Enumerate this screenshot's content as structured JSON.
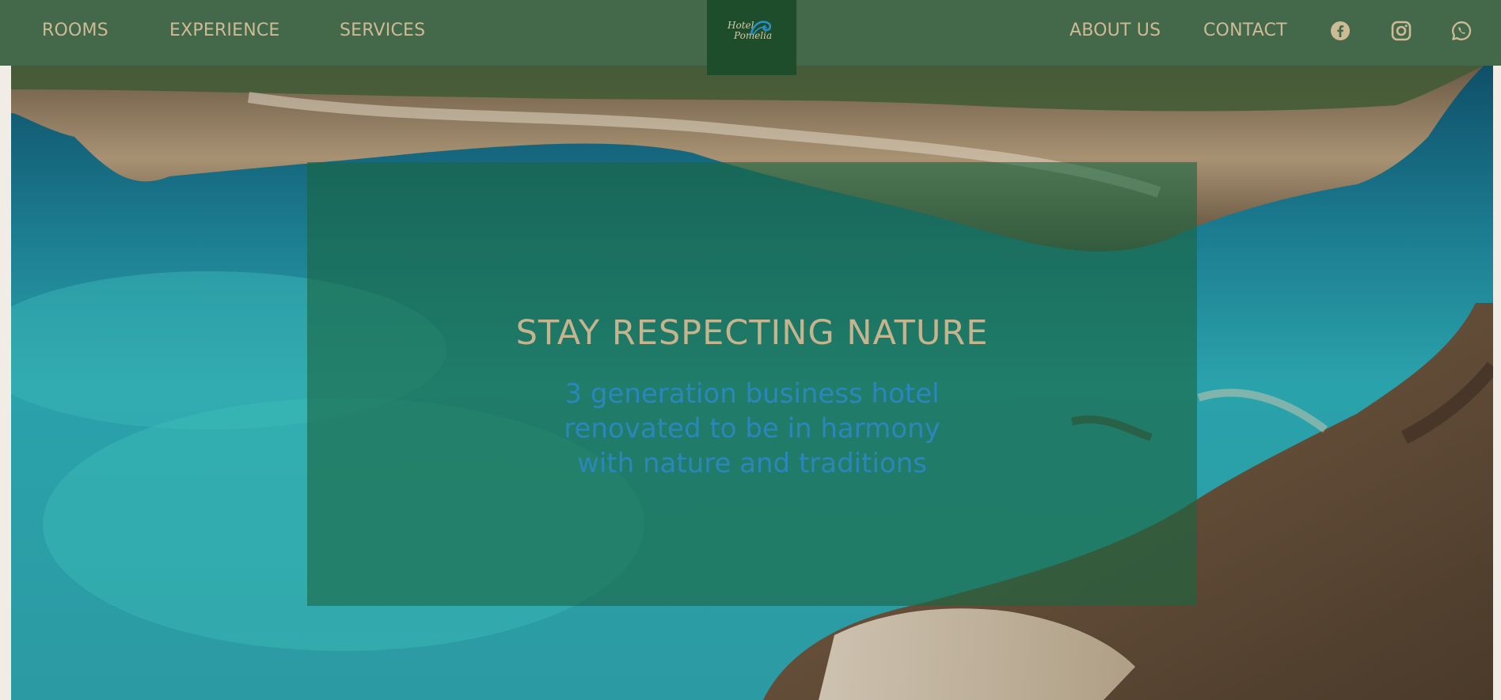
{
  "nav": {
    "rooms": "ROOMS",
    "experience": "EXPERIENCE",
    "services": "SERVICES",
    "about": "ABOUT US",
    "contact": "CONTACT"
  },
  "logo": {
    "line1": "Hotel",
    "line2": "Pomelia"
  },
  "social": [
    "facebook-icon",
    "instagram-icon",
    "whatsapp-icon"
  ],
  "hero": {
    "title": "STAY RESPECTING NATURE",
    "subtitle": "3 generation business hotel renovated to be in harmony with nature and traditions"
  },
  "colors": {
    "nav_bg": "#44684a",
    "logo_bg": "#1e4d2c",
    "nav_text": "#cdbb95",
    "overlay": "#1a6640",
    "title": "#c6b48f",
    "subtitle": "#2b86b9"
  }
}
